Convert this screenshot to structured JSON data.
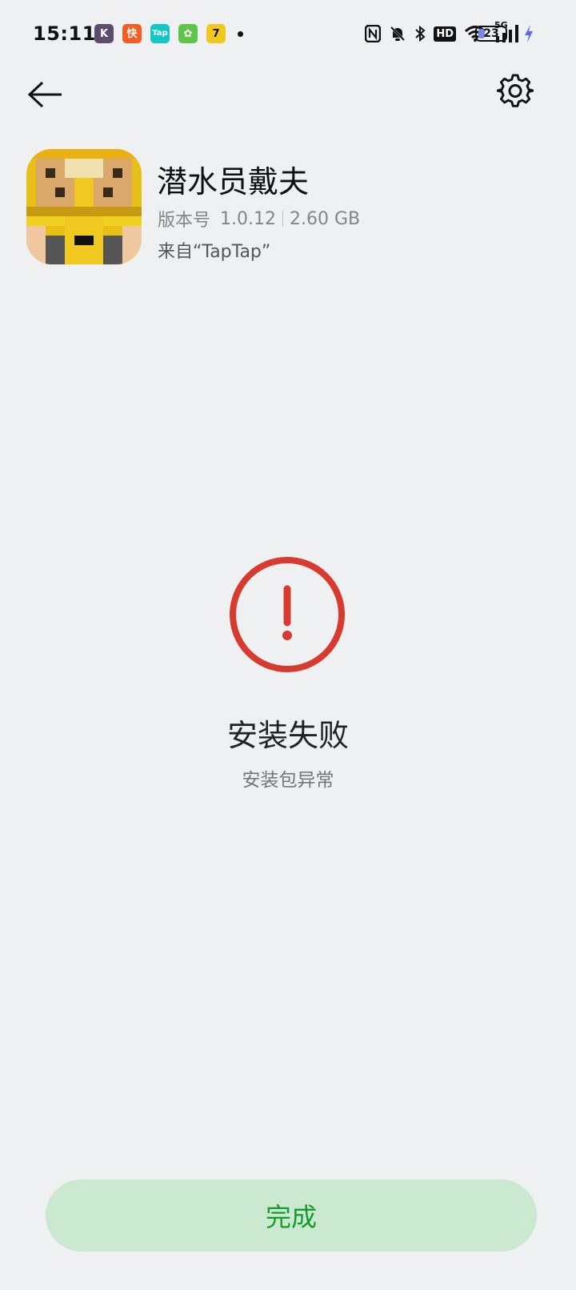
{
  "status_bar": {
    "time": "15:11",
    "notifications": [
      {
        "name": "k-app-icon",
        "glyph": "K",
        "color": "#5b4d6b"
      },
      {
        "name": "kuaishou-icon",
        "glyph": "快",
        "color": "#f35c23"
      },
      {
        "name": "taptap-icon",
        "glyph": "Tap",
        "color": "#14c7c4"
      },
      {
        "name": "green-app-icon",
        "glyph": "✿",
        "color": "#5fc44a"
      },
      {
        "name": "seven-app-icon",
        "glyph": "7",
        "color": "#f0c820"
      }
    ],
    "network": "5G",
    "hd": "HD",
    "battery_level": "23",
    "battery_fraction": 0.23
  },
  "header": {
    "back_icon": "arrow-left-icon",
    "settings_icon": "gear-icon"
  },
  "app": {
    "name": "潜水员戴夫",
    "version_label": "版本号",
    "version": "1.0.12",
    "size": "2.60 GB",
    "source": "来自“TapTap”"
  },
  "result": {
    "icon": "error-icon",
    "title": "安装失败",
    "reason": "安装包异常",
    "error_color": "#d73a2f"
  },
  "actions": {
    "done_label": "完成",
    "done_color": "#159c2d",
    "done_background": "#cbe8d0"
  }
}
